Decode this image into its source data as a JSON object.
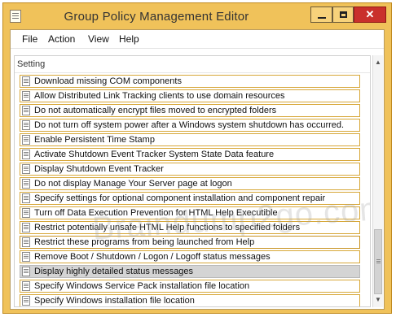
{
  "window": {
    "title": "Group Policy Management Editor"
  },
  "menubar": {
    "items": [
      "File",
      "Action",
      "View",
      "Help"
    ]
  },
  "list": {
    "column_header": "Setting",
    "rows": [
      "Download missing COM components",
      "Allow Distributed Link Tracking clients to use domain resources",
      "Do not automatically encrypt files moved to encrypted folders",
      "Do not turn off system power after a Windows system shutdown has occurred.",
      "Enable Persistent Time Stamp",
      "Activate Shutdown Event Tracker System State Data feature",
      "Display Shutdown Event Tracker",
      "Do not display Manage Your Server page at logon",
      "Specify settings for optional component installation and component repair",
      "Turn off Data Execution Prevention for HTML Help Executible",
      "Restrict potentially unsafe HTML Help functions to specified folders",
      "Restrict these programs from being launched from Help",
      "Remove Boot / Shutdown / Logon / Logoff status messages",
      "Display highly detailed status messages",
      "Specify Windows Service Pack installation file location",
      "Specify Windows installation file location"
    ],
    "selected_row": "Display highly detailed status messages"
  },
  "watermark": "Braindump2go.com"
}
